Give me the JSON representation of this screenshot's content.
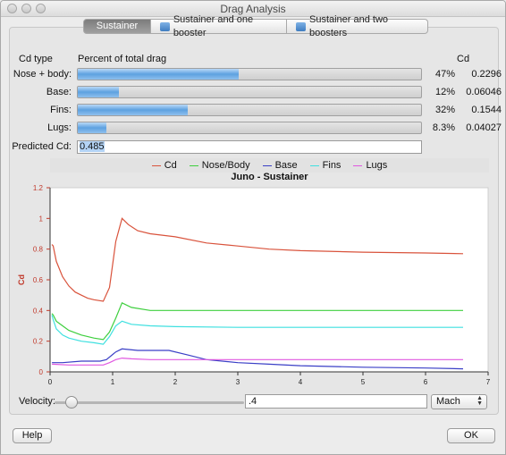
{
  "window": {
    "title": "Drag Analysis"
  },
  "tabs": [
    {
      "label": "Sustainer",
      "active": true
    },
    {
      "label": "Sustainer and one booster",
      "icon": "booster-icon"
    },
    {
      "label": "Sustainer and two boosters",
      "icon": "booster-icon"
    }
  ],
  "table": {
    "headers": {
      "cd_type": "Cd type",
      "percent": "Percent of total drag",
      "cd": "Cd"
    },
    "rows": [
      {
        "label": "Nose + body:",
        "percent": "47%",
        "percent_value": 0.47,
        "cd": "0.2296"
      },
      {
        "label": "Base:",
        "percent": "12%",
        "percent_value": 0.12,
        "cd": "0.06046"
      },
      {
        "label": "Fins:",
        "percent": "32%",
        "percent_value": 0.32,
        "cd": "0.1544"
      },
      {
        "label": "Lugs:",
        "percent": "8.3%",
        "percent_value": 0.083,
        "cd": "0.04027"
      }
    ],
    "predicted_label": "Predicted Cd:",
    "predicted_value": "0.485"
  },
  "chart_data": {
    "type": "line",
    "title": "Juno - Sustainer",
    "ylabel": "Cd",
    "xlabel": "",
    "xlim": [
      0,
      7
    ],
    "ylim": [
      0,
      1.2
    ],
    "x_ticks": [
      "0",
      "1",
      "2",
      "3",
      "4",
      "5",
      "6",
      "7"
    ],
    "y_ticks": [
      "0",
      "0.2",
      "0.4",
      "0.6",
      "0.8",
      "1",
      "1.2"
    ],
    "legend_position": "top",
    "series": [
      {
        "name": "Cd",
        "color": "#d9533c",
        "points": [
          [
            0.03,
            0.83
          ],
          [
            0.05,
            0.82
          ],
          [
            0.1,
            0.72
          ],
          [
            0.2,
            0.62
          ],
          [
            0.3,
            0.56
          ],
          [
            0.4,
            0.52
          ],
          [
            0.5,
            0.5
          ],
          [
            0.6,
            0.48
          ],
          [
            0.7,
            0.47
          ],
          [
            0.85,
            0.46
          ],
          [
            0.95,
            0.55
          ],
          [
            1.05,
            0.85
          ],
          [
            1.15,
            1.0
          ],
          [
            1.25,
            0.96
          ],
          [
            1.4,
            0.92
          ],
          [
            1.6,
            0.9
          ],
          [
            2.0,
            0.88
          ],
          [
            2.5,
            0.84
          ],
          [
            3.0,
            0.82
          ],
          [
            3.5,
            0.8
          ],
          [
            4.0,
            0.79
          ],
          [
            5.0,
            0.78
          ],
          [
            6.0,
            0.775
          ],
          [
            6.6,
            0.77
          ]
        ]
      },
      {
        "name": "Nose/Body",
        "color": "#3ecf3e",
        "points": [
          [
            0.03,
            0.38
          ],
          [
            0.05,
            0.37
          ],
          [
            0.1,
            0.33
          ],
          [
            0.2,
            0.3
          ],
          [
            0.3,
            0.27
          ],
          [
            0.5,
            0.24
          ],
          [
            0.7,
            0.22
          ],
          [
            0.85,
            0.21
          ],
          [
            0.95,
            0.26
          ],
          [
            1.05,
            0.35
          ],
          [
            1.15,
            0.45
          ],
          [
            1.3,
            0.42
          ],
          [
            1.6,
            0.4
          ],
          [
            2.0,
            0.4
          ],
          [
            3.0,
            0.4
          ],
          [
            4.0,
            0.4
          ],
          [
            5.0,
            0.4
          ],
          [
            6.6,
            0.4
          ]
        ]
      },
      {
        "name": "Base",
        "color": "#3a3fc6",
        "points": [
          [
            0.03,
            0.06
          ],
          [
            0.2,
            0.06
          ],
          [
            0.5,
            0.07
          ],
          [
            0.8,
            0.07
          ],
          [
            0.9,
            0.08
          ],
          [
            1.05,
            0.13
          ],
          [
            1.15,
            0.15
          ],
          [
            1.4,
            0.14
          ],
          [
            1.9,
            0.14
          ],
          [
            2.2,
            0.11
          ],
          [
            2.5,
            0.08
          ],
          [
            3.0,
            0.06
          ],
          [
            3.5,
            0.05
          ],
          [
            4.0,
            0.04
          ],
          [
            5.0,
            0.03
          ],
          [
            6.0,
            0.025
          ],
          [
            6.6,
            0.02
          ]
        ]
      },
      {
        "name": "Fins",
        "color": "#3fe0e0",
        "points": [
          [
            0.03,
            0.37
          ],
          [
            0.05,
            0.34
          ],
          [
            0.1,
            0.28
          ],
          [
            0.2,
            0.24
          ],
          [
            0.3,
            0.22
          ],
          [
            0.5,
            0.2
          ],
          [
            0.7,
            0.19
          ],
          [
            0.85,
            0.18
          ],
          [
            0.95,
            0.23
          ],
          [
            1.05,
            0.3
          ],
          [
            1.15,
            0.33
          ],
          [
            1.3,
            0.31
          ],
          [
            1.6,
            0.3
          ],
          [
            2.0,
            0.295
          ],
          [
            3.0,
            0.29
          ],
          [
            4.0,
            0.29
          ],
          [
            5.0,
            0.29
          ],
          [
            6.6,
            0.29
          ]
        ]
      },
      {
        "name": "Lugs",
        "color": "#e058e0",
        "points": [
          [
            0.03,
            0.05
          ],
          [
            0.3,
            0.045
          ],
          [
            0.6,
            0.045
          ],
          [
            0.85,
            0.045
          ],
          [
            0.95,
            0.06
          ],
          [
            1.05,
            0.08
          ],
          [
            1.15,
            0.09
          ],
          [
            1.3,
            0.085
          ],
          [
            1.6,
            0.08
          ],
          [
            2.0,
            0.08
          ],
          [
            3.0,
            0.08
          ],
          [
            4.0,
            0.08
          ],
          [
            5.0,
            0.08
          ],
          [
            6.6,
            0.08
          ]
        ]
      }
    ]
  },
  "velocity": {
    "label": "Velocity:",
    "value": ".4",
    "slider_fraction": 0.06,
    "unit": "Mach"
  },
  "buttons": {
    "help": "Help",
    "ok": "OK"
  }
}
